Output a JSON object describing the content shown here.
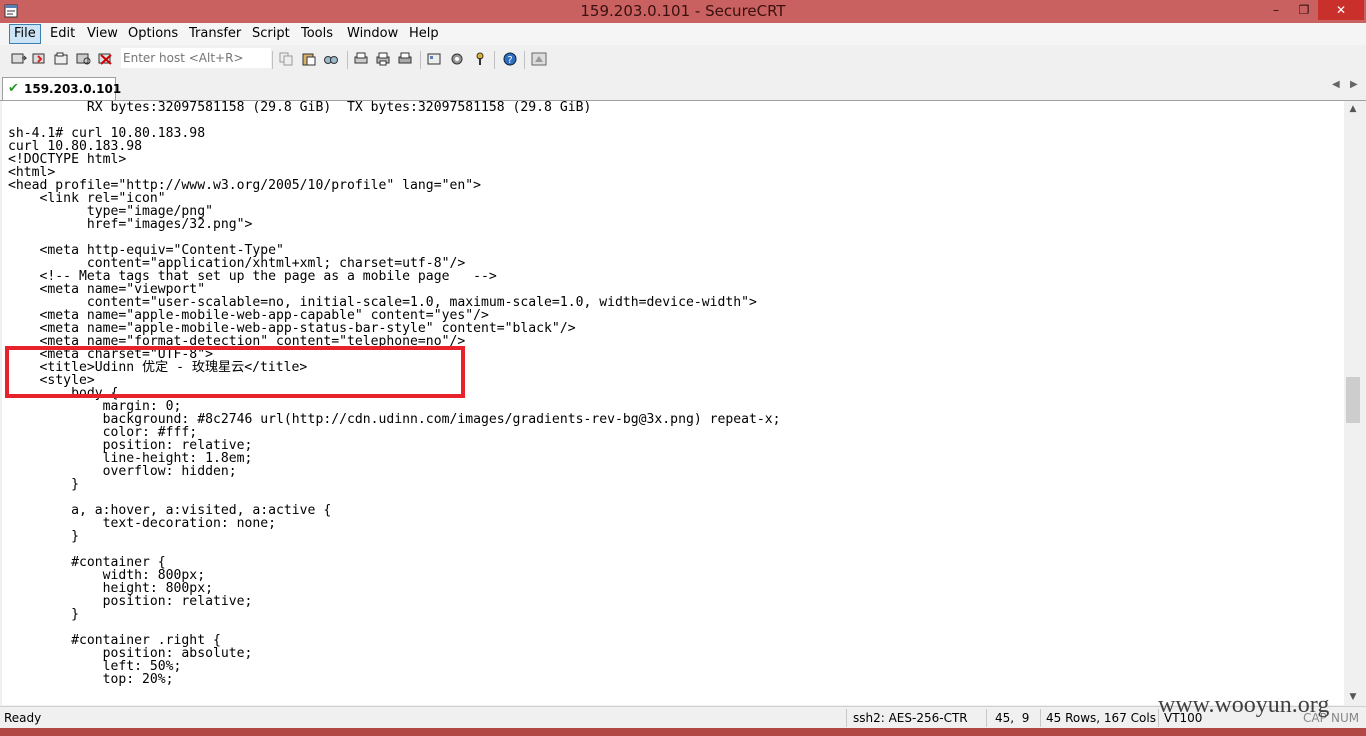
{
  "window": {
    "title": "159.203.0.101 - SecureCRT",
    "minimize": "–",
    "maximize": "❐",
    "close": "✕"
  },
  "menu": [
    "File",
    "Edit",
    "View",
    "Options",
    "Transfer",
    "Script",
    "Tools",
    "Window",
    "Help"
  ],
  "toolbar": {
    "host_placeholder": "Enter host <Alt+R>"
  },
  "tabs": [
    {
      "label": "159.203.0.101",
      "status_icon": "connected-check-icon",
      "active": true
    }
  ],
  "terminal": {
    "lines": [
      "          RX bytes:32097581158 (29.8 GiB)  TX bytes:32097581158 (29.8 GiB)",
      "",
      "sh-4.1# curl 10.80.183.98",
      "curl 10.80.183.98",
      "<!DOCTYPE html>",
      "<html>",
      "<head profile=\"http://www.w3.org/2005/10/profile\" lang=\"en\">",
      "    <link rel=\"icon\"",
      "          type=\"image/png\"",
      "          href=\"images/32.png\">",
      "",
      "    <meta http-equiv=\"Content-Type\"",
      "          content=\"application/xhtml+xml; charset=utf-8\"/>",
      "    <!-- Meta tags that set up the page as a mobile page   -->",
      "    <meta name=\"viewport\"",
      "          content=\"user-scalable=no, initial-scale=1.0, maximum-scale=1.0, width=device-width\">",
      "    <meta name=\"apple-mobile-web-app-capable\" content=\"yes\"/>",
      "    <meta name=\"apple-mobile-web-app-status-bar-style\" content=\"black\"/>",
      "    <meta name=\"format-detection\" content=\"telephone=no\"/>",
      "    <meta charset=\"UTF-8\">",
      "    <title>Udinn 优定 - 玫瑰星云</title>",
      "    <style>",
      "        body {",
      "            margin: 0;",
      "            background: #8c2746 url(http://cdn.udinn.com/images/gradients-rev-bg@3x.png) repeat-x;",
      "            color: #fff;",
      "            position: relative;",
      "            line-height: 1.8em;",
      "            overflow: hidden;",
      "        }",
      "",
      "        a, a:hover, a:visited, a:active {",
      "            text-decoration: none;",
      "        }",
      "",
      "        #container {",
      "            width: 800px;",
      "            height: 800px;",
      "            position: relative;",
      "        }",
      "",
      "        #container .right {",
      "            position: absolute;",
      "            left: 50%;",
      "            top: 20%;"
    ]
  },
  "status": {
    "ready": "Ready",
    "cipher": "ssh2: AES-256-CTR",
    "cursor": "45,  9",
    "size": "45 Rows, 167 Cols",
    "emulation": "VT100",
    "cap": "CAP",
    "num": "NUM"
  },
  "watermark": "www.wooyun.org",
  "colors": {
    "titlebar": "#c8615f",
    "highlight": "#e8222a"
  }
}
